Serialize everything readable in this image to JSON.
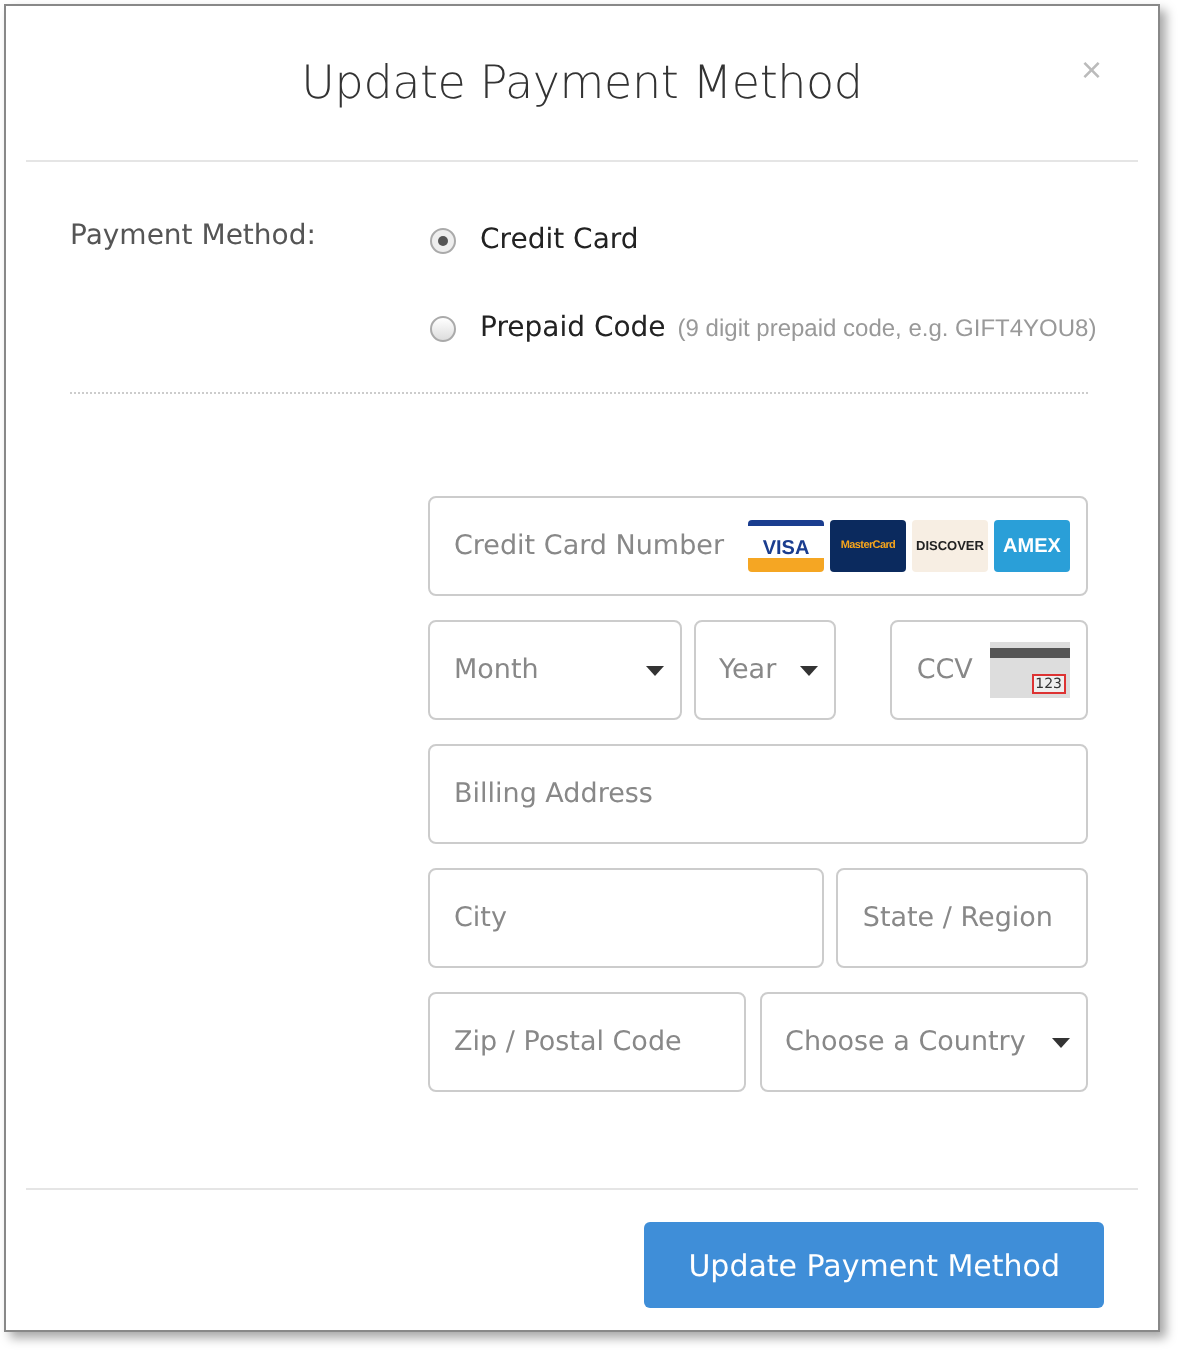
{
  "dialog": {
    "title": "Update Payment Method",
    "close": "×"
  },
  "payment_method": {
    "label": "Payment Method:",
    "options": [
      {
        "label": "Credit Card",
        "selected": true
      },
      {
        "label": "Prepaid Code",
        "hint": "(9 digit prepaid code, e.g. GIFT4YOU8)",
        "selected": false
      }
    ]
  },
  "form_rows": [
    [
      {
        "kind": "card",
        "placeholder": "Credit Card Number",
        "logos": [
          "VISA",
          "MasterCard",
          "DISCOVER",
          "AMEX"
        ]
      }
    ],
    [
      {
        "kind": "select",
        "placeholder": "Month"
      },
      {
        "kind": "select",
        "placeholder": "Year"
      },
      {
        "kind": "ccv",
        "placeholder": "CCV",
        "code": "123"
      }
    ],
    [
      {
        "kind": "text",
        "placeholder": "Billing Address"
      }
    ],
    [
      {
        "kind": "text",
        "placeholder": "City"
      },
      {
        "kind": "text",
        "placeholder": "State / Region"
      }
    ],
    [
      {
        "kind": "text",
        "placeholder": "Zip / Postal Code"
      },
      {
        "kind": "select",
        "placeholder": "Choose a Country"
      }
    ]
  ],
  "submit": "Update Payment Method"
}
